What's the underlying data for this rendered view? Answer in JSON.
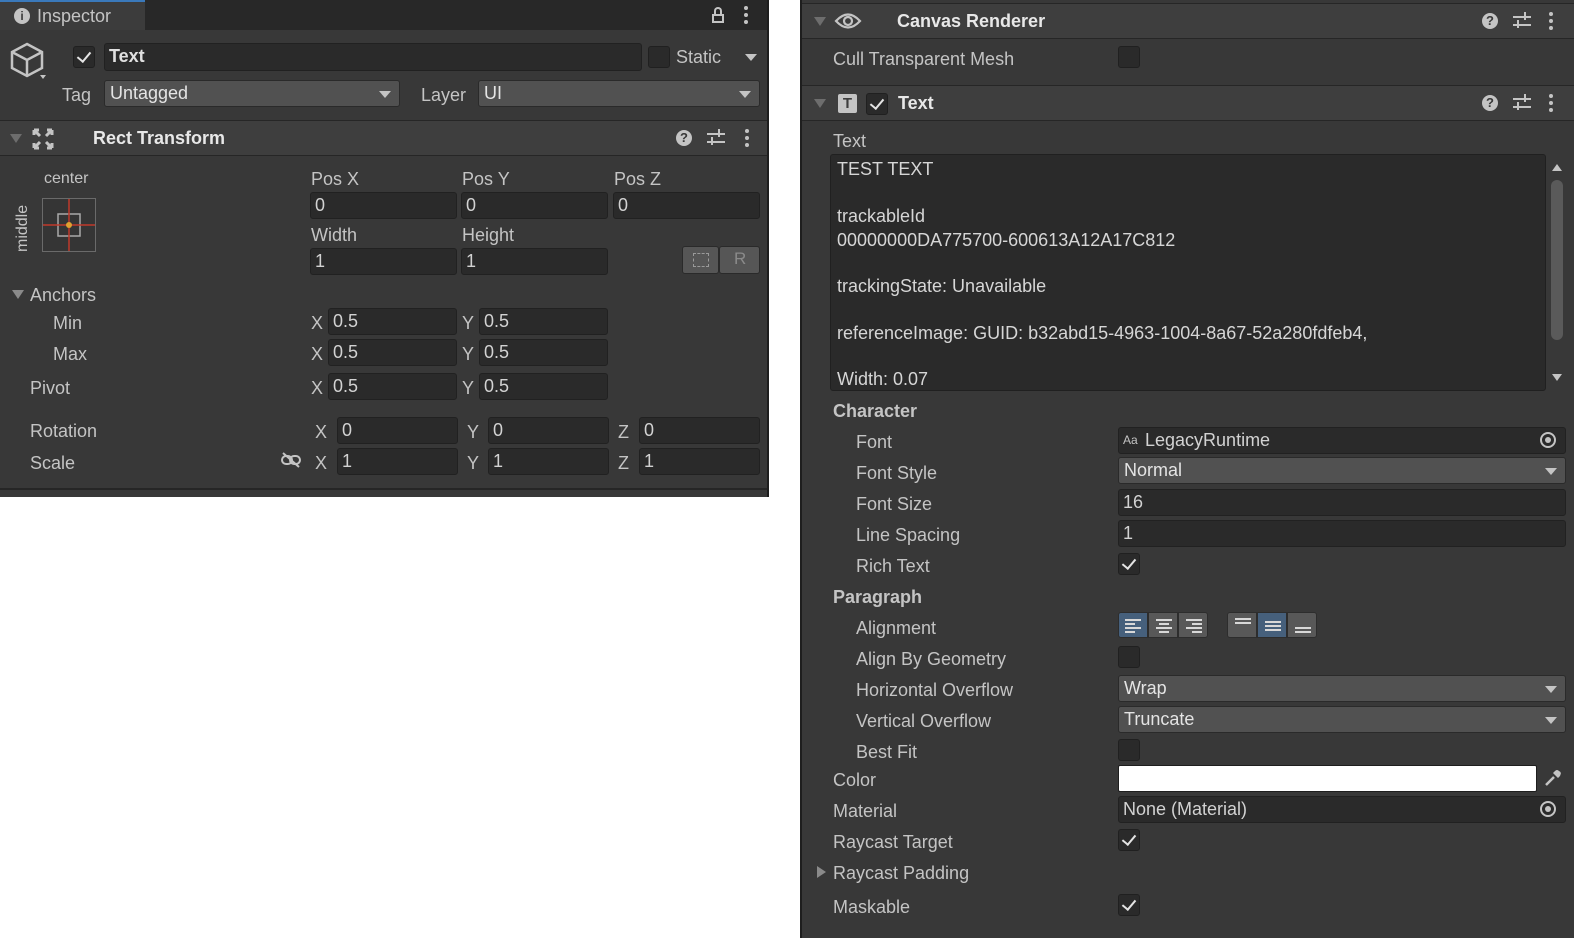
{
  "inspector": {
    "tab_label": "Inspector",
    "object_name": "Text",
    "static_label": "Static",
    "tag_label": "Tag",
    "tag_value": "Untagged",
    "layer_label": "Layer",
    "layer_value": "UI"
  },
  "rect_transform": {
    "title": "Rect Transform",
    "anchor_h": "center",
    "anchor_v": "middle",
    "pos_x_label": "Pos X",
    "pos_y_label": "Pos Y",
    "pos_z_label": "Pos Z",
    "pos_x": "0",
    "pos_y": "0",
    "pos_z": "0",
    "width_label": "Width",
    "height_label": "Height",
    "width": "1",
    "height": "1",
    "r_button": "R",
    "anchors_label": "Anchors",
    "min_label": "Min",
    "max_label": "Max",
    "pivot_label": "Pivot",
    "rotation_label": "Rotation",
    "scale_label": "Scale",
    "x": "X",
    "y": "Y",
    "z": "Z",
    "min_x": "0.5",
    "min_y": "0.5",
    "max_x": "0.5",
    "max_y": "0.5",
    "pivot_x": "0.5",
    "pivot_y": "0.5",
    "rot_x": "0",
    "rot_y": "0",
    "rot_z": "0",
    "scale_x": "1",
    "scale_y": "1",
    "scale_z": "1"
  },
  "canvas_renderer": {
    "title": "Canvas Renderer",
    "cull_label": "Cull Transparent Mesh",
    "cull_checked": false
  },
  "text_component": {
    "title": "Text",
    "text_label": "Text",
    "text_lines": {
      "l1": "TEST TEXT",
      "l2": "trackableId",
      "l3": "00000000DA775700-600613A12A17C812",
      "l4": "trackingState: Unavailable",
      "l5": "referenceImage: GUID: b32abd15-4963-1004-8a67-52a280fdfeb4,",
      "l6": "Width: 0.07"
    },
    "character_label": "Character",
    "font_label": "Font",
    "font_value": "LegacyRuntime",
    "font_style_label": "Font Style",
    "font_style_value": "Normal",
    "font_size_label": "Font Size",
    "font_size_value": "16",
    "line_spacing_label": "Line Spacing",
    "line_spacing_value": "1",
    "rich_text_label": "Rich Text",
    "rich_text_checked": true,
    "paragraph_label": "Paragraph",
    "alignment_label": "Alignment",
    "align_by_geometry_label": "Align By Geometry",
    "align_by_geometry_checked": false,
    "horizontal_overflow_label": "Horizontal Overflow",
    "horizontal_overflow_value": "Wrap",
    "vertical_overflow_label": "Vertical Overflow",
    "vertical_overflow_value": "Truncate",
    "best_fit_label": "Best Fit",
    "best_fit_checked": false,
    "color_label": "Color",
    "color_value": "#ffffff",
    "material_label": "Material",
    "material_value": "None (Material)",
    "raycast_target_label": "Raycast Target",
    "raycast_target_checked": true,
    "raycast_padding_label": "Raycast Padding",
    "maskable_label": "Maskable",
    "maskable_checked": true,
    "font_icon_text": "Aa",
    "component_icon_text": "T"
  }
}
